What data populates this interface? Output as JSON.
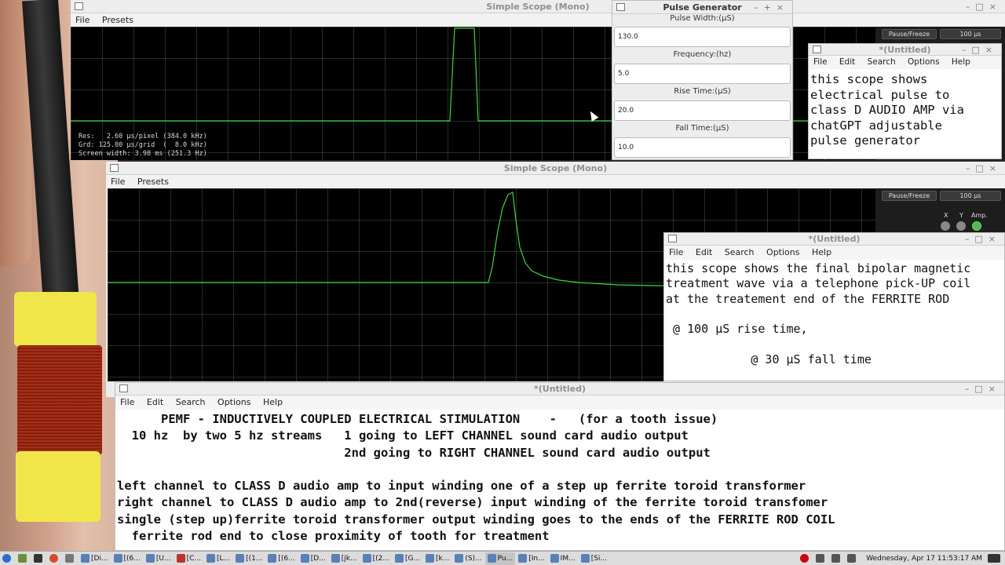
{
  "scope_top": {
    "title": "Simple Scope (Mono)",
    "menu": [
      "File",
      "Presets"
    ],
    "readout": "Res:   2.60 µs/pixel (384.0 kHz)\nGrd: 125.00 µs/grid  (  8.0 kHz)\nScreen width: 3.98 ms (251.3 Hz)",
    "pause_label": "Pause/Freeze",
    "timebase": "100 µs"
  },
  "pulse_generator": {
    "title": "Pulse Generator",
    "fields": [
      {
        "label": "Pulse Width:(µS)",
        "value": "130.0"
      },
      {
        "label": "Frequency:(hz)",
        "value": "5.0"
      },
      {
        "label": "Rise Time:(µS)",
        "value": "20.0"
      },
      {
        "label": "Fall Time:(µS)",
        "value": "10.0"
      }
    ]
  },
  "editor_small": {
    "title": "*(Untitled)",
    "menu": [
      "File",
      "Edit",
      "Search",
      "Options",
      "Help"
    ],
    "text": "this scope shows\nelectrical pulse to\nclass D AUDIO AMP via\nchatGPT adjustable\npulse generator"
  },
  "scope_bottom": {
    "title": "Simple Scope (Mono)",
    "menu": [
      "File",
      "Presets"
    ],
    "pause_label": "Pause/Freeze",
    "timebase": "100 µs",
    "knob_labels": [
      "X",
      "Y",
      "Amp."
    ]
  },
  "editor_mid": {
    "title": "*(Untitled)",
    "menu": [
      "File",
      "Edit",
      "Search",
      "Options",
      "Help"
    ],
    "text": "this scope shows the final bipolar magnetic\ntreatment wave via a telephone pick-UP coil\nat the treatement end of the FERRITE ROD\n\n @ 100 µS rise time,\n\n            @ 30 µS fall time"
  },
  "editor_bottom": {
    "title": "*(Untitled)",
    "menu": [
      "File",
      "Edit",
      "Search",
      "Options",
      "Help"
    ],
    "text": "      PEMF - INDUCTIVELY COUPLED ELECTRICAL STIMULATION    -   (for a tooth issue)\n  10 hz  by two 5 hz streams   1 going to LEFT CHANNEL sound card audio output\n                               2nd going to RIGHT CHANNEL sound card audio output\n\nleft channel to CLASS D audio amp to input winding one of a step up ferrite toroid transformer\nright channel to CLASS D audio amp to 2nd(reverse) input winding of the ferrite toroid transfomer\nsingle (step up)ferrite toroid transformer output winding goes to the ends of the FERRITE ROD COIL\n  ferrite rod end to close proximity of tooth for treatment"
  },
  "taskbar": {
    "tasks": [
      "[Di...",
      "[(6...",
      "[U...",
      "[C...",
      "[L...",
      "[(1...",
      "[(6...",
      "[D...",
      "[jk...",
      "[(2...",
      "[G...",
      "[k...",
      "(S)...",
      "Pu...",
      "[In...",
      "IM...",
      "[Si..."
    ],
    "clock": "Wednesday, Apr 17 11:53:17 AM"
  },
  "colors": {
    "trace": "#3fd63f",
    "grid": "#3c5a3c",
    "scope_bg": "#000000"
  }
}
